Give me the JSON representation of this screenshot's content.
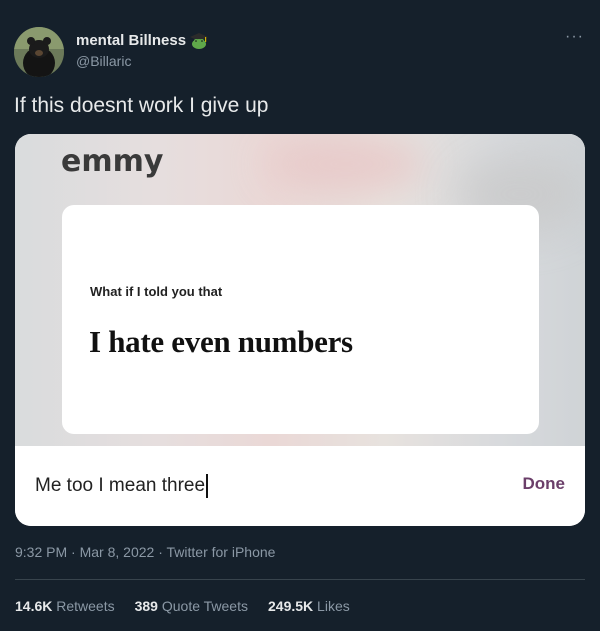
{
  "user": {
    "display_name": "mental Billness",
    "handle": "@Billaric",
    "badge_icon": "frog-graduate-emoji-icon"
  },
  "tweet": {
    "text": "If this doesnt work I give up",
    "more_icon": "more-options-icon"
  },
  "media": {
    "app_name": "emmy",
    "prompt": "What if I told you that",
    "statement": "I hate even numbers",
    "answer_value": "Me too I mean three",
    "done_label": "Done"
  },
  "meta": {
    "time": "9:32 PM",
    "date": "Mar 8, 2022",
    "source": "Twitter for iPhone",
    "separator": "·"
  },
  "stats": {
    "retweets_count": "14.6K",
    "retweets_label": "Retweets",
    "quotes_count": "389",
    "quotes_label": "Quote Tweets",
    "likes_count": "249.5K",
    "likes_label": "Likes"
  },
  "colors": {
    "background": "#15202b",
    "text": "#e7e9ea",
    "muted": "#8b98a5",
    "done_accent": "#6b3f6a"
  }
}
